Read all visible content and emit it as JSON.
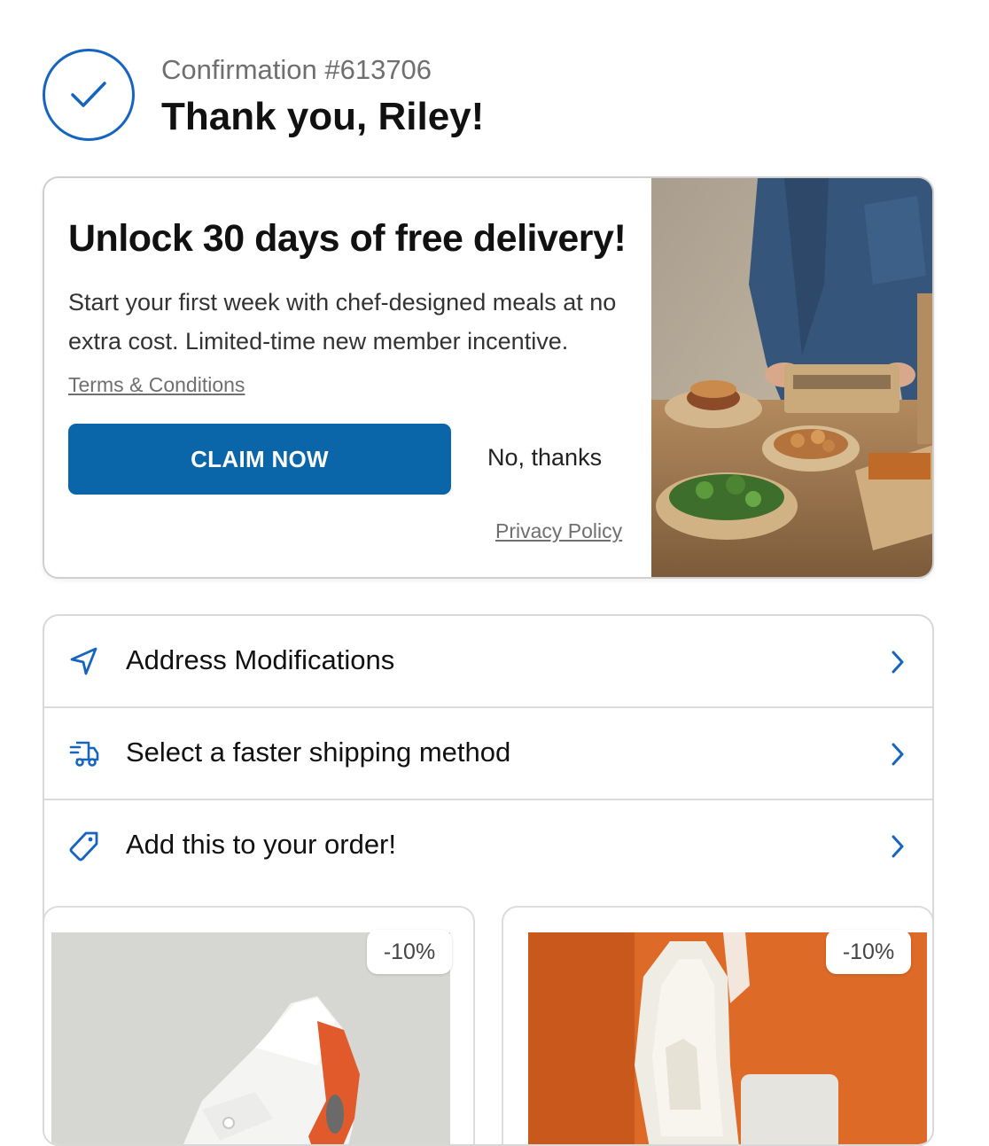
{
  "header": {
    "confirmation": "Confirmation #613706",
    "thank_you": "Thank you, Riley!"
  },
  "promo": {
    "title": "Unlock 30 days of free delivery!",
    "description": "Start your first week with chef-designed meals at no extra cost. Limited-time new member incentive.",
    "terms_label": "Terms & Conditions",
    "claim_label": "CLAIM NOW",
    "decline_label": "No, thanks",
    "privacy_label": "Privacy Policy"
  },
  "actions": [
    {
      "label": "Address Modifications",
      "icon": "navigation-arrow-icon"
    },
    {
      "label": "Select a faster shipping method",
      "icon": "delivery-truck-icon"
    },
    {
      "label": "Add this to your order!",
      "icon": "price-tag-icon"
    }
  ],
  "products": [
    {
      "discount": "-10%",
      "image": "white-orange-sneaker"
    },
    {
      "discount": "-10%",
      "image": "white-sneaker-sole-orange-background"
    }
  ],
  "colors": {
    "accent": "#1565c0",
    "button": "#0a66a8",
    "muted_text": "#6f6f6f"
  }
}
